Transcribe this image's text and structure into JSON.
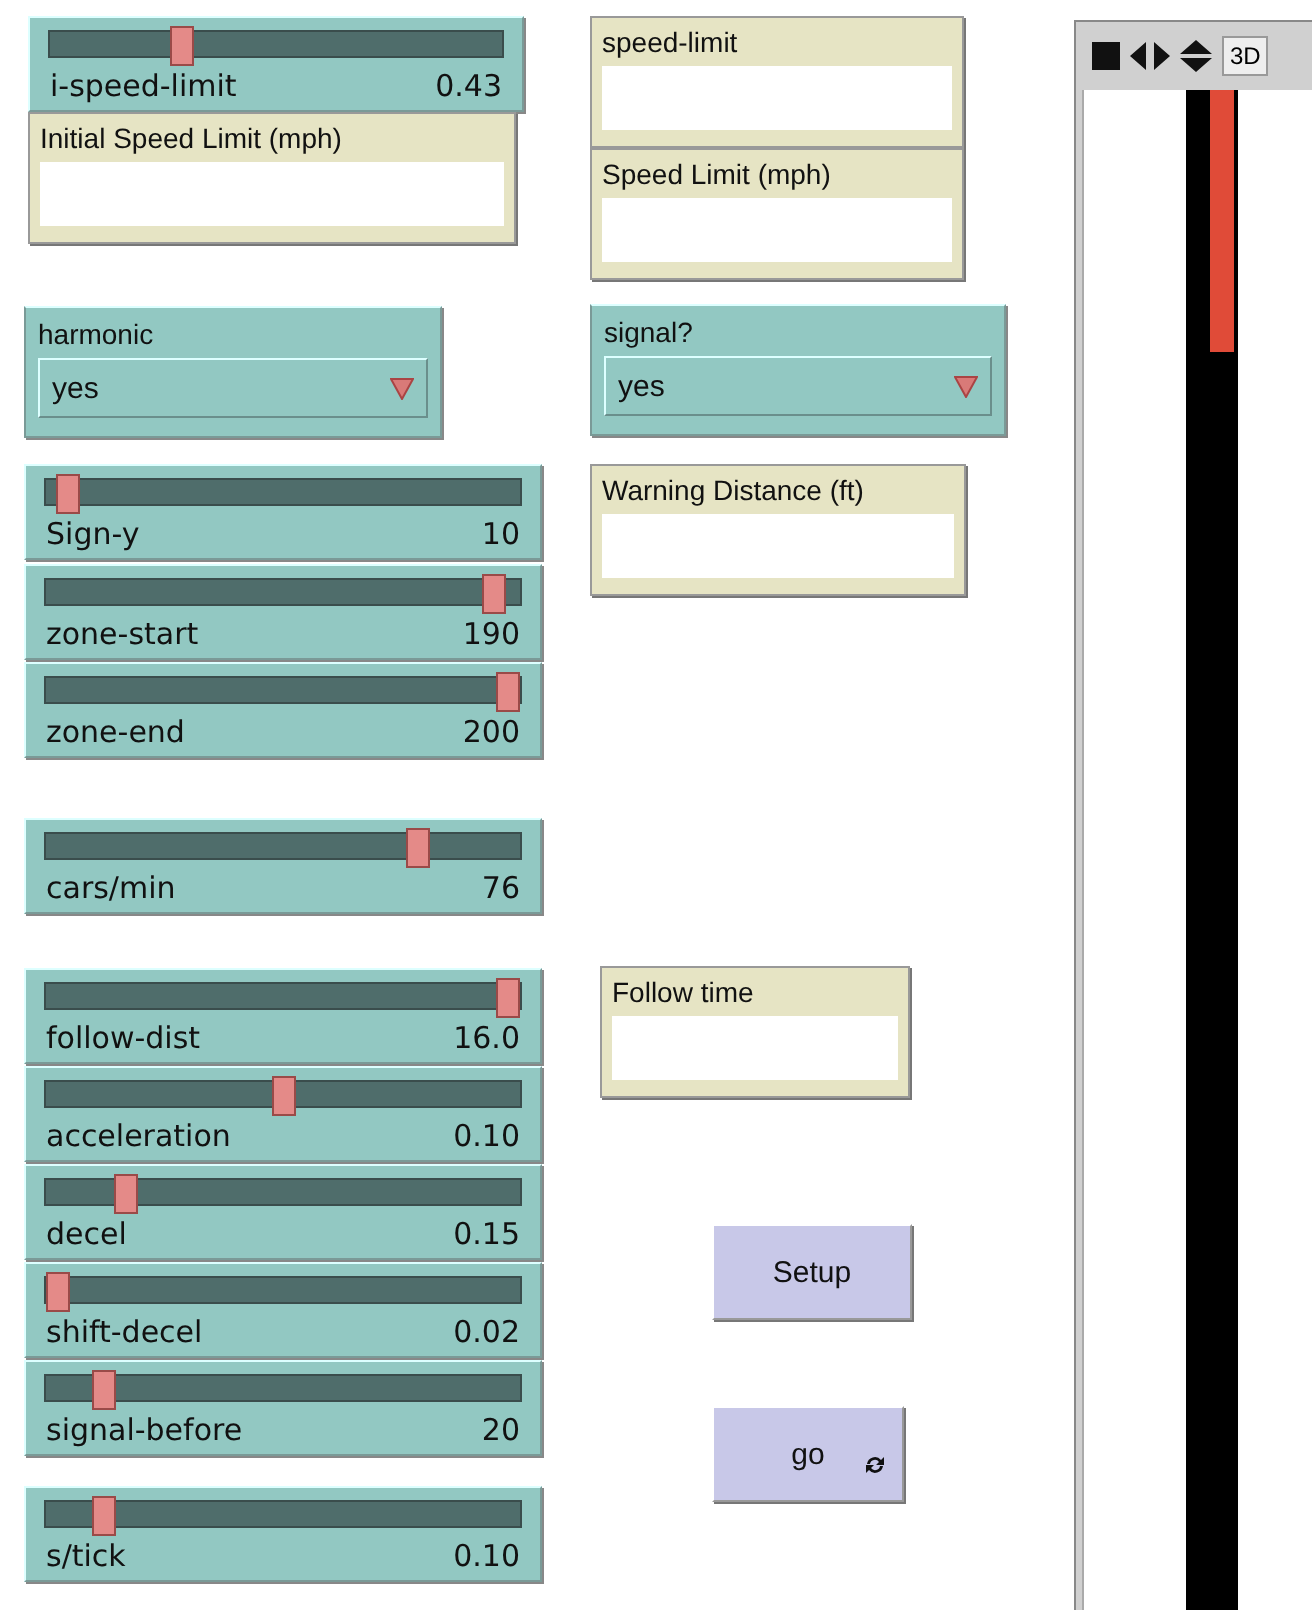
{
  "widgets": [
    {
      "kind": "slider",
      "label": "i-speed-limit",
      "value": "0.43",
      "level": 0.28
    },
    {
      "kind": "monitor",
      "label": "Initial Speed Limit (mph)"
    },
    {
      "kind": "monitor",
      "label": "speed-limit"
    },
    {
      "kind": "monitor",
      "label": "Speed Limit (mph)"
    },
    {
      "kind": "chooser",
      "label": "harmonic",
      "value": "yes"
    },
    {
      "kind": "chooser",
      "label": "signal?",
      "value": "yes"
    },
    {
      "kind": "slider",
      "label": "Sign-y",
      "value": "10",
      "level": 0.02
    },
    {
      "kind": "monitor",
      "label": "Warning Distance (ft)"
    },
    {
      "kind": "slider",
      "label": "zone-start",
      "value": "190",
      "level": 0.97
    },
    {
      "kind": "slider",
      "label": "zone-end",
      "value": "200",
      "level": 1
    },
    {
      "kind": "slider",
      "label": "cars/min",
      "value": "76",
      "level": 0.8
    },
    {
      "kind": "slider",
      "label": "follow-dist",
      "value": "16.0",
      "level": 1
    },
    {
      "kind": "monitor",
      "label": "Follow time"
    },
    {
      "kind": "slider",
      "label": "acceleration",
      "value": "0.10",
      "level": 0.5
    },
    {
      "kind": "slider",
      "label": "decel",
      "value": "0.15",
      "level": 0.15
    },
    {
      "kind": "slider",
      "label": "shift-decel",
      "value": "0.02",
      "level": 0
    },
    {
      "kind": "button",
      "label": "Setup",
      "forever": false
    },
    {
      "kind": "slider",
      "label": "signal-before",
      "value": "20",
      "level": 0.1
    },
    {
      "kind": "button",
      "label": "go",
      "forever": true
    },
    {
      "kind": "slider",
      "label": "s/tick",
      "value": "0.10",
      "level": 0.1
    }
  ],
  "view": {
    "button": "3D",
    "level": 0.17
  }
}
